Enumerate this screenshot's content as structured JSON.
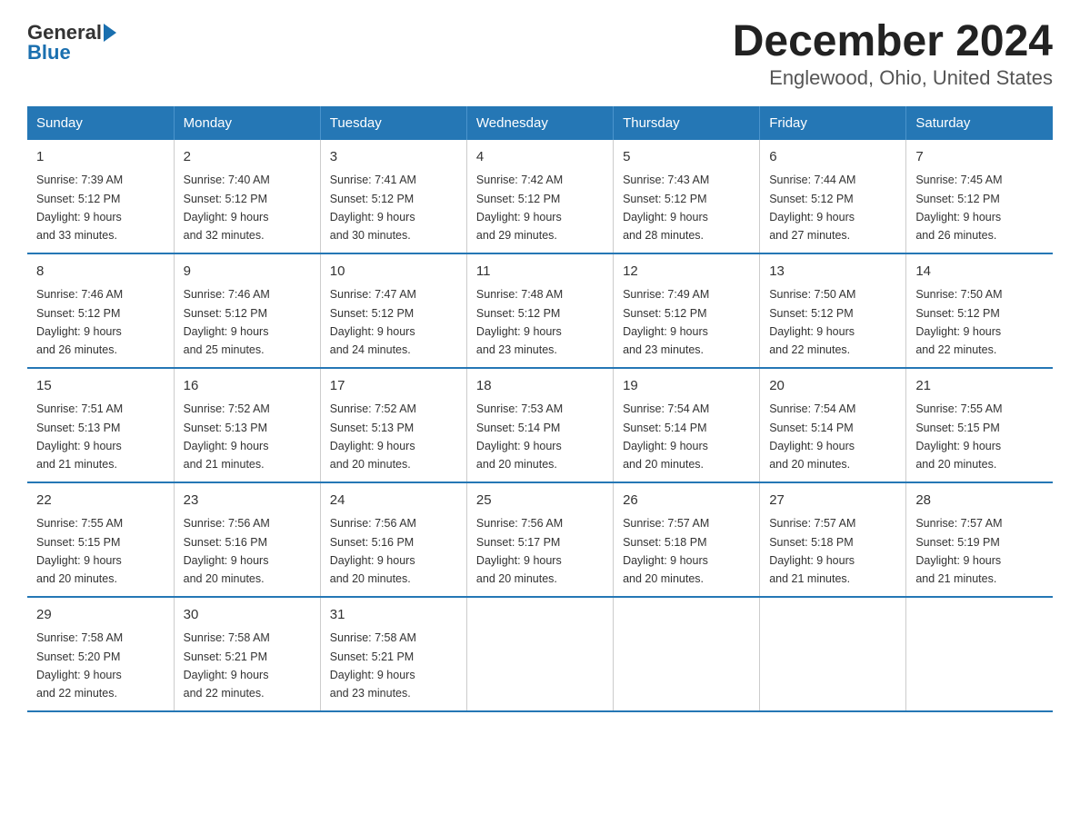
{
  "logo": {
    "general": "General",
    "blue": "Blue"
  },
  "title": "December 2024",
  "subtitle": "Englewood, Ohio, United States",
  "days_of_week": [
    "Sunday",
    "Monday",
    "Tuesday",
    "Wednesday",
    "Thursday",
    "Friday",
    "Saturday"
  ],
  "weeks": [
    [
      {
        "day": "1",
        "sunrise": "7:39 AM",
        "sunset": "5:12 PM",
        "daylight": "9 hours and 33 minutes."
      },
      {
        "day": "2",
        "sunrise": "7:40 AM",
        "sunset": "5:12 PM",
        "daylight": "9 hours and 32 minutes."
      },
      {
        "day": "3",
        "sunrise": "7:41 AM",
        "sunset": "5:12 PM",
        "daylight": "9 hours and 30 minutes."
      },
      {
        "day": "4",
        "sunrise": "7:42 AM",
        "sunset": "5:12 PM",
        "daylight": "9 hours and 29 minutes."
      },
      {
        "day": "5",
        "sunrise": "7:43 AM",
        "sunset": "5:12 PM",
        "daylight": "9 hours and 28 minutes."
      },
      {
        "day": "6",
        "sunrise": "7:44 AM",
        "sunset": "5:12 PM",
        "daylight": "9 hours and 27 minutes."
      },
      {
        "day": "7",
        "sunrise": "7:45 AM",
        "sunset": "5:12 PM",
        "daylight": "9 hours and 26 minutes."
      }
    ],
    [
      {
        "day": "8",
        "sunrise": "7:46 AM",
        "sunset": "5:12 PM",
        "daylight": "9 hours and 26 minutes."
      },
      {
        "day": "9",
        "sunrise": "7:46 AM",
        "sunset": "5:12 PM",
        "daylight": "9 hours and 25 minutes."
      },
      {
        "day": "10",
        "sunrise": "7:47 AM",
        "sunset": "5:12 PM",
        "daylight": "9 hours and 24 minutes."
      },
      {
        "day": "11",
        "sunrise": "7:48 AM",
        "sunset": "5:12 PM",
        "daylight": "9 hours and 23 minutes."
      },
      {
        "day": "12",
        "sunrise": "7:49 AM",
        "sunset": "5:12 PM",
        "daylight": "9 hours and 23 minutes."
      },
      {
        "day": "13",
        "sunrise": "7:50 AM",
        "sunset": "5:12 PM",
        "daylight": "9 hours and 22 minutes."
      },
      {
        "day": "14",
        "sunrise": "7:50 AM",
        "sunset": "5:12 PM",
        "daylight": "9 hours and 22 minutes."
      }
    ],
    [
      {
        "day": "15",
        "sunrise": "7:51 AM",
        "sunset": "5:13 PM",
        "daylight": "9 hours and 21 minutes."
      },
      {
        "day": "16",
        "sunrise": "7:52 AM",
        "sunset": "5:13 PM",
        "daylight": "9 hours and 21 minutes."
      },
      {
        "day": "17",
        "sunrise": "7:52 AM",
        "sunset": "5:13 PM",
        "daylight": "9 hours and 20 minutes."
      },
      {
        "day": "18",
        "sunrise": "7:53 AM",
        "sunset": "5:14 PM",
        "daylight": "9 hours and 20 minutes."
      },
      {
        "day": "19",
        "sunrise": "7:54 AM",
        "sunset": "5:14 PM",
        "daylight": "9 hours and 20 minutes."
      },
      {
        "day": "20",
        "sunrise": "7:54 AM",
        "sunset": "5:14 PM",
        "daylight": "9 hours and 20 minutes."
      },
      {
        "day": "21",
        "sunrise": "7:55 AM",
        "sunset": "5:15 PM",
        "daylight": "9 hours and 20 minutes."
      }
    ],
    [
      {
        "day": "22",
        "sunrise": "7:55 AM",
        "sunset": "5:15 PM",
        "daylight": "9 hours and 20 minutes."
      },
      {
        "day": "23",
        "sunrise": "7:56 AM",
        "sunset": "5:16 PM",
        "daylight": "9 hours and 20 minutes."
      },
      {
        "day": "24",
        "sunrise": "7:56 AM",
        "sunset": "5:16 PM",
        "daylight": "9 hours and 20 minutes."
      },
      {
        "day": "25",
        "sunrise": "7:56 AM",
        "sunset": "5:17 PM",
        "daylight": "9 hours and 20 minutes."
      },
      {
        "day": "26",
        "sunrise": "7:57 AM",
        "sunset": "5:18 PM",
        "daylight": "9 hours and 20 minutes."
      },
      {
        "day": "27",
        "sunrise": "7:57 AM",
        "sunset": "5:18 PM",
        "daylight": "9 hours and 21 minutes."
      },
      {
        "day": "28",
        "sunrise": "7:57 AM",
        "sunset": "5:19 PM",
        "daylight": "9 hours and 21 minutes."
      }
    ],
    [
      {
        "day": "29",
        "sunrise": "7:58 AM",
        "sunset": "5:20 PM",
        "daylight": "9 hours and 22 minutes."
      },
      {
        "day": "30",
        "sunrise": "7:58 AM",
        "sunset": "5:21 PM",
        "daylight": "9 hours and 22 minutes."
      },
      {
        "day": "31",
        "sunrise": "7:58 AM",
        "sunset": "5:21 PM",
        "daylight": "9 hours and 23 minutes."
      },
      null,
      null,
      null,
      null
    ]
  ]
}
